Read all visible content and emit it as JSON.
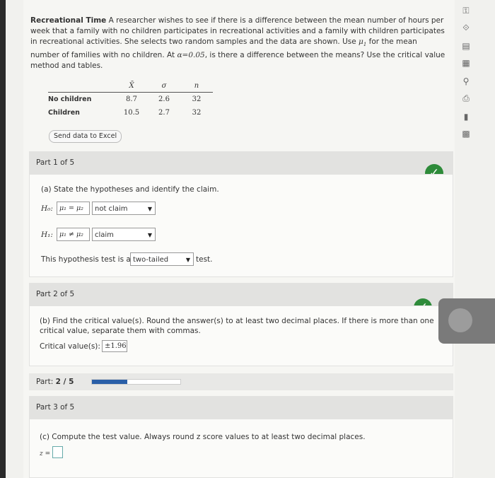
{
  "problem": {
    "title": "Recreational Time",
    "text_a": "A researcher wishes to see if there is a difference between the mean number of hours per week that a family with no children participates in recreational activities and a family with children participates in recreational activities. She selects two random samples and the data are shown. Use ",
    "mu1": "μ",
    "mu1_sub": "1",
    "text_b": " for the mean number of families with no children. At ",
    "alpha": "α=0.05",
    "text_c": ", is there a difference between the means? Use the critical value method and tables."
  },
  "table": {
    "headers": [
      "X̄",
      "σ",
      "n"
    ],
    "rows": [
      {
        "label": "No children",
        "xbar": "8.7",
        "sigma": "2.6",
        "n": "32"
      },
      {
        "label": "Children",
        "xbar": "10.5",
        "sigma": "2.7",
        "n": "32"
      }
    ]
  },
  "excel_button": "Send data to Excel",
  "part1": {
    "header": "Part 1 of 5",
    "question": "(a) State the hypotheses and identify the claim.",
    "h0_label": "H₀:",
    "h0_expr": "μ₁ = μ₂",
    "h0_claim": "not claim",
    "h1_label": "H₁:",
    "h1_expr": "μ₁ ≠ μ₂",
    "h1_claim": "claim",
    "test_prefix": "This hypothesis test is a",
    "test_type": "two-tailed",
    "test_suffix": "test."
  },
  "part2": {
    "header": "Part 2 of 5",
    "question": "(b) Find the critical value(s). Round the answer(s) to at least two decimal places. If there is more than one critical value, separate them with commas.",
    "answer_label": "Critical value(s):",
    "answer_value": "±1.96"
  },
  "progress": {
    "label": "Part:",
    "value": "2 / 5",
    "fraction": 0.4
  },
  "part3": {
    "header": "Part 3 of 5",
    "question": "(c) Compute the test value. Always round z score values to at least two decimal places.",
    "z_label": "z ="
  },
  "status_colors": {
    "correct": "#2e8b3a",
    "progress": "#2a5fa8"
  },
  "tools": [
    "key-icon",
    "eraser-icon",
    "book-icon",
    "calculator-icon",
    "accessibility-icon",
    "print-icon",
    "bar-chart-icon",
    "table-icon"
  ]
}
